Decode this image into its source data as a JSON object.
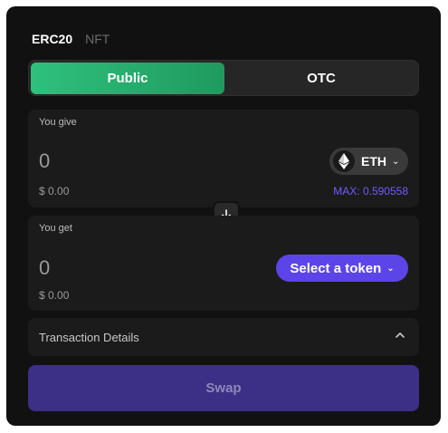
{
  "tabs": {
    "erc20": "ERC20",
    "nft": "NFT"
  },
  "mode": {
    "public": "Public",
    "otc": "OTC"
  },
  "give": {
    "label": "You give",
    "amount": "0",
    "usd": "$ 0.00",
    "token": "ETH",
    "max": "MAX: 0.590558"
  },
  "get": {
    "label": "You get",
    "amount": "0",
    "usd": "$ 0.00",
    "select": "Select a token"
  },
  "details": {
    "label": "Transaction Details"
  },
  "action": {
    "swap": "Swap"
  },
  "colors": {
    "accent_green": "#2fc07e",
    "accent_purple": "#5b45e8",
    "max_text": "#6e5cff",
    "swap_button": "#3b2f86"
  },
  "icons": {
    "token": "eth-icon",
    "switch": "arrow-down-icon",
    "details": "chevron-up-icon",
    "dropdown": "chevron-down-icon"
  }
}
